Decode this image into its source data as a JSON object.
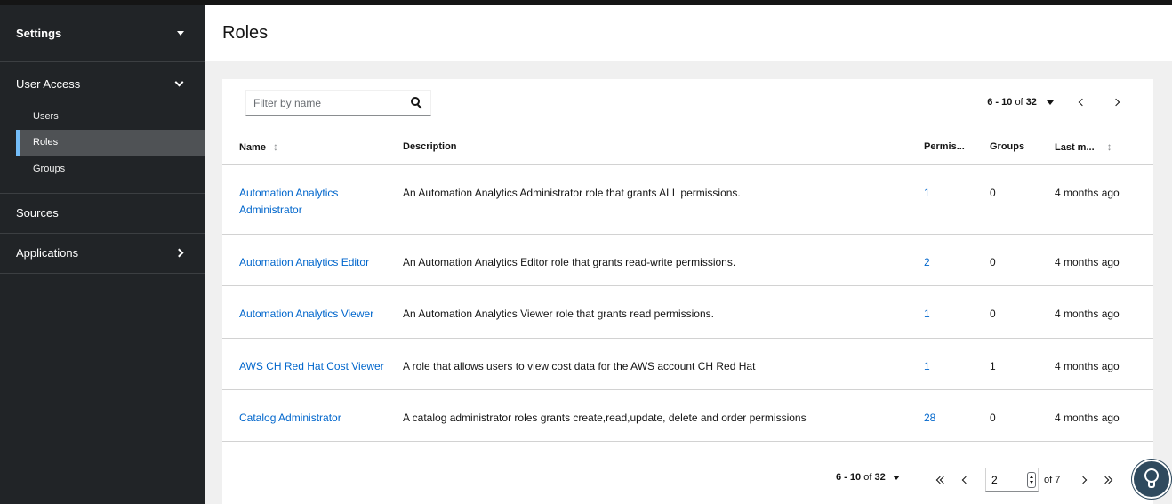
{
  "sidebar": {
    "title": "Settings",
    "sections": [
      {
        "label": "User Access",
        "expanded": true,
        "items": [
          {
            "label": "Users"
          },
          {
            "label": "Roles",
            "active": true
          },
          {
            "label": "Groups"
          }
        ]
      },
      {
        "label": "Sources"
      },
      {
        "label": "Applications"
      }
    ]
  },
  "page": {
    "title": "Roles"
  },
  "filter": {
    "placeholder": "Filter by name",
    "value": ""
  },
  "pagination": {
    "range": "6 - 10",
    "of_label": "of",
    "total": "32",
    "page": "2",
    "page_total_label": "of 7"
  },
  "table": {
    "columns": {
      "name": "Name",
      "description": "Description",
      "permissions": "Permis...",
      "groups": "Groups",
      "last_modified": "Last m..."
    },
    "rows": [
      {
        "name": "Automation Analytics Administrator",
        "description": "An Automation Analytics Administrator role that grants ALL permissions.",
        "permissions": "1",
        "groups": "0",
        "last_modified": "4 months ago"
      },
      {
        "name": "Automation Analytics Editor",
        "description": "An Automation Analytics Editor role that grants read-write permissions.",
        "permissions": "2",
        "groups": "0",
        "last_modified": "4 months ago"
      },
      {
        "name": "Automation Analytics Viewer",
        "description": "An Automation Analytics Viewer role that grants read permissions.",
        "permissions": "1",
        "groups": "0",
        "last_modified": "4 months ago"
      },
      {
        "name": "AWS CH Red Hat Cost Viewer",
        "description": "A role that allows users to view cost data for the AWS account CH Red Hat",
        "permissions": "1",
        "groups": "1",
        "last_modified": "4 months ago"
      },
      {
        "name": "Catalog Administrator",
        "description": "A catalog administrator roles grants create,read,update, delete and order permissions",
        "permissions": "28",
        "groups": "0",
        "last_modified": "4 months ago"
      }
    ]
  },
  "colors": {
    "link": "#0066cc",
    "sidebar_bg": "#212427",
    "active_accent": "#73bcf7"
  },
  "icons": {
    "search": "search-icon",
    "help": "lightbulb-icon"
  }
}
